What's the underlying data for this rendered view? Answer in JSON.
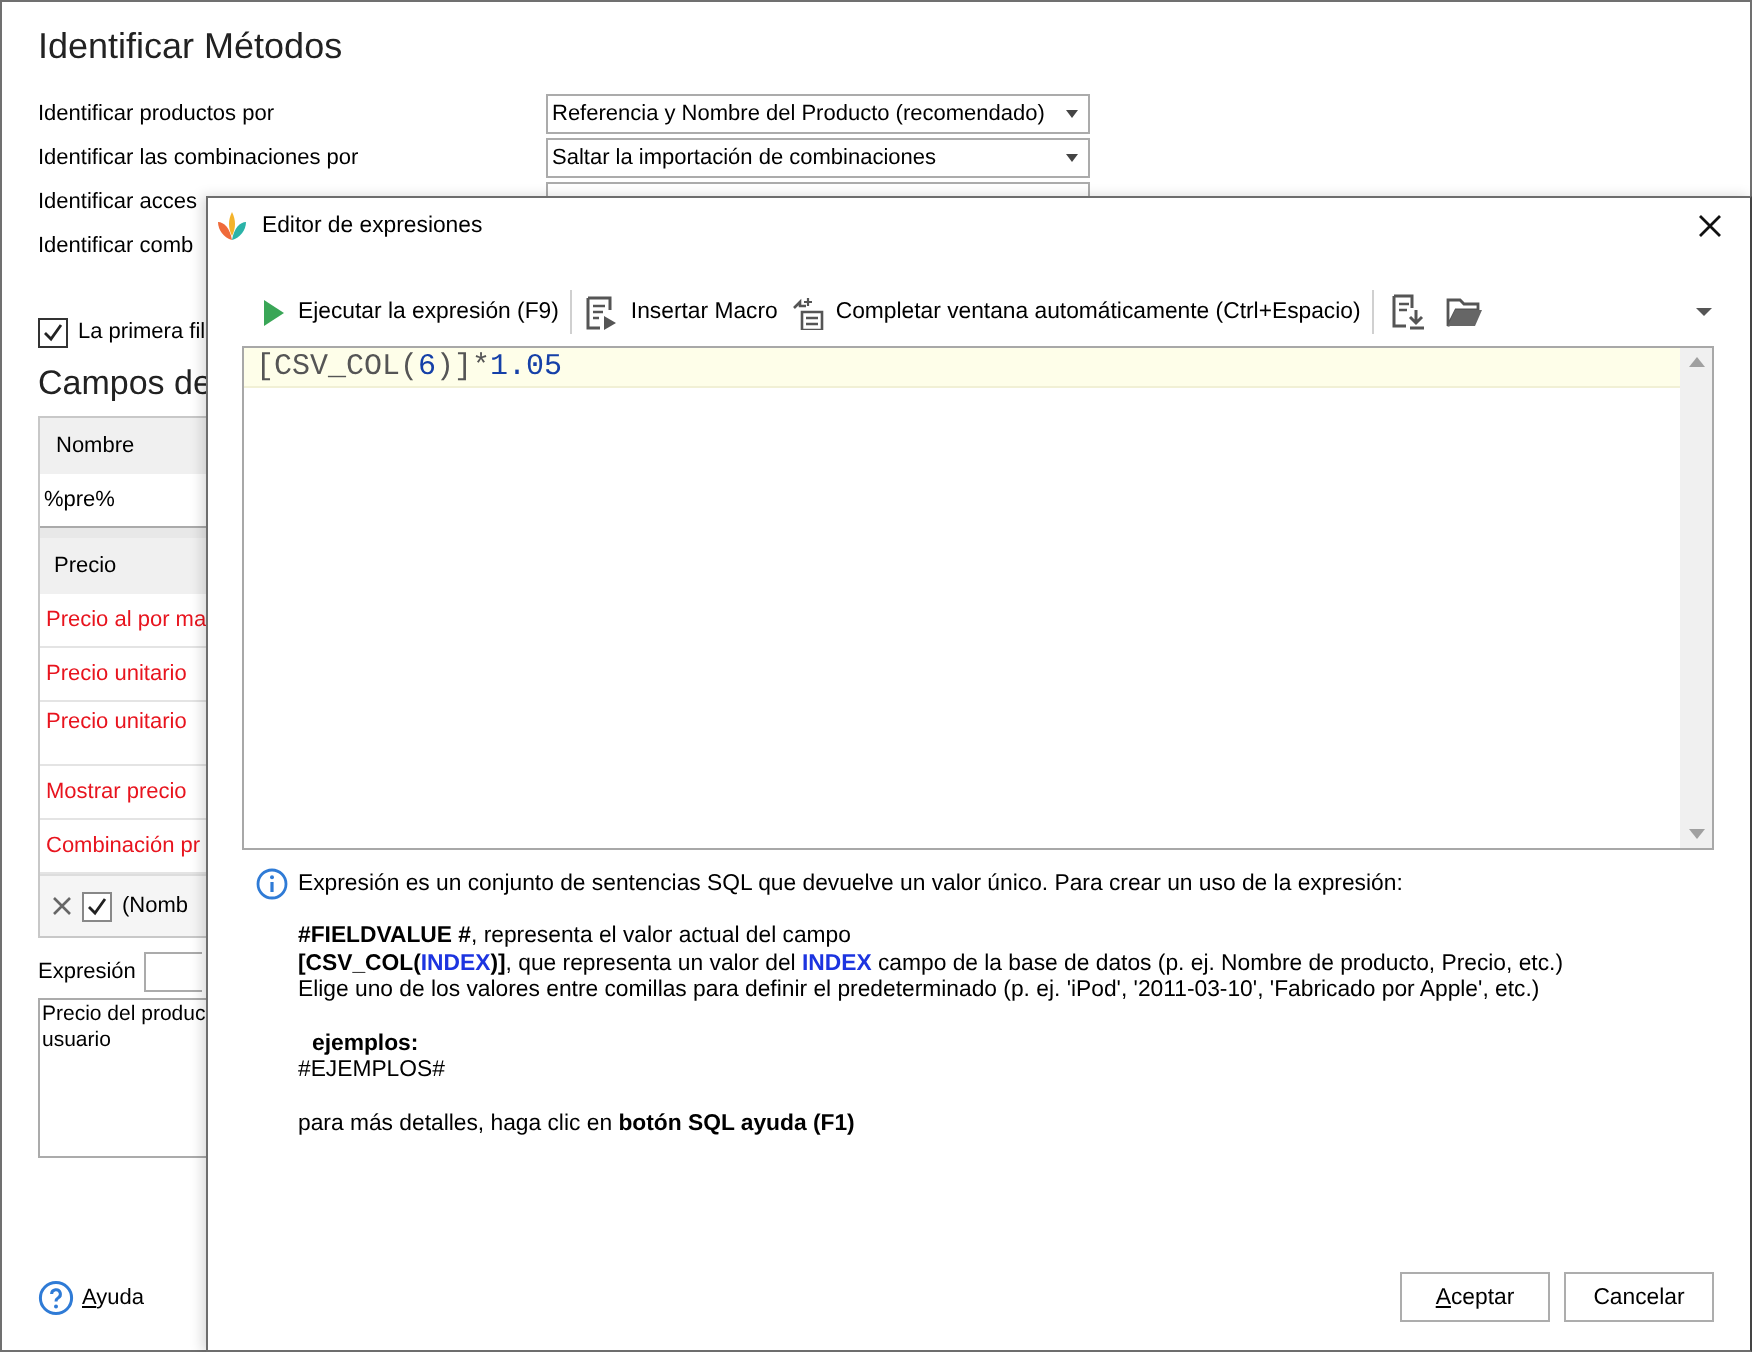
{
  "window": {
    "title": "Identificar Métodos",
    "settings": [
      {
        "label": "Identificar productos por",
        "value": "Referencia y Nombre del Producto (recomendado)"
      },
      {
        "label": "Identificar las combinaciones por",
        "value": "Saltar la importación de combinaciones"
      },
      {
        "label": "Identificar acces"
      },
      {
        "label": "Identificar comb"
      }
    ],
    "first_row_checkbox": {
      "label": "La primera fil",
      "checked": true
    },
    "section_title": "Campos de",
    "fields_grid": {
      "column_header": "Nombre",
      "filter_value": "%pre%",
      "group_header": "Precio",
      "rows": [
        {
          "label": "Precio al por ma",
          "required": true
        },
        {
          "label": "Precio unitario",
          "required": true
        },
        {
          "label": "Precio unitario",
          "required": true
        },
        {
          "label": "Mostrar precio",
          "required": true
        },
        {
          "label": "Combinación pr",
          "required": true
        }
      ],
      "footer": {
        "filter_enabled": true,
        "filter_text": "(Nomb"
      }
    },
    "expression": {
      "label": "Expresión"
    },
    "description": [
      "Precio del produc",
      "usuario"
    ],
    "help_link": {
      "label": "Ayuda",
      "mnemonic_underlined": true
    }
  },
  "dialog": {
    "title": "Editor de expresiones",
    "toolbar": [
      {
        "kind": "run",
        "label": "Ejecutar la expresión (F9)"
      },
      {
        "kind": "separator"
      },
      {
        "kind": "macro",
        "label": "Insertar Macro"
      },
      {
        "kind": "autocomplete",
        "label": "Completar ventana automáticamente (Ctrl+Espacio)"
      },
      {
        "kind": "separator"
      },
      {
        "kind": "export"
      },
      {
        "kind": "folder"
      }
    ],
    "code": "[CSV_COL(6)]*1.05",
    "info": {
      "intro": "Expresión es un conjunto de sentencias SQL que devuelve un valor único. Para crear un uso de la expresión:",
      "groups": [
        [
          {
            "kind": "text",
            "parts": [
              {
                "kind": "bold",
                "text": "#FIELDVALUE #"
              },
              {
                "kind": "plain",
                "text": ", representa el valor actual del campo"
              }
            ]
          },
          {
            "kind": "text",
            "parts": [
              {
                "kind": "bold",
                "text": "[CSV_COL("
              },
              {
                "kind": "keyword",
                "text": "INDEX"
              },
              {
                "kind": "bold",
                "text": ")]"
              },
              {
                "kind": "plain",
                "text": ", que representa un valor del "
              },
              {
                "kind": "keyword",
                "text": "INDEX"
              },
              {
                "kind": "plain",
                "text": " campo de la base de datos (p. ej. Nombre de producto, Precio, etc.)"
              }
            ]
          },
          {
            "kind": "text",
            "parts": [
              {
                "kind": "plain",
                "text": "Elige uno de los valores entre comillas para definir el predeterminado (p. ej. 'iPod', '2011-03-10', 'Fabricado por Apple', etc.)"
              }
            ]
          }
        ],
        [
          {
            "kind": "subheading",
            "parts": [
              {
                "kind": "bold",
                "text": "ejemplos:"
              }
            ]
          },
          {
            "kind": "text",
            "parts": [
              {
                "kind": "plain",
                "text": "#EJEMPLOS#"
              }
            ]
          }
        ],
        [
          {
            "kind": "text",
            "parts": [
              {
                "kind": "plain",
                "text": "para más detalles, haga clic en "
              },
              {
                "kind": "bold",
                "text": "botón SQL ayuda (F1)"
              }
            ]
          }
        ]
      ]
    },
    "buttons": [
      {
        "label": "Aceptar",
        "mnemonic_underlined": true
      },
      {
        "label": "Cancelar",
        "mnemonic_underlined": false
      }
    ]
  }
}
